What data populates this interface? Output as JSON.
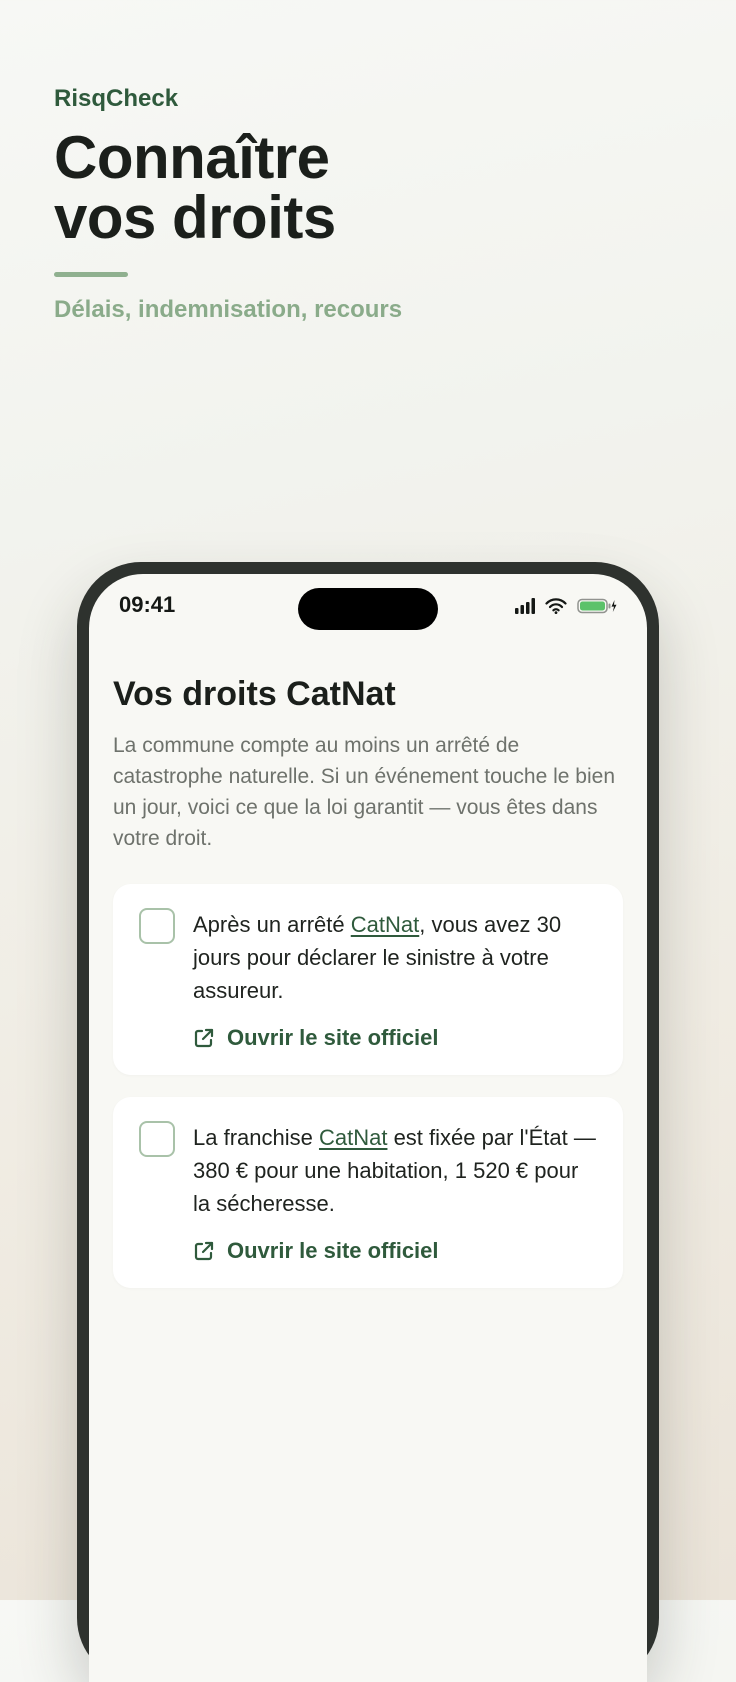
{
  "promo": {
    "brand": "RisqCheck",
    "headline_line1": "Connaître",
    "headline_line2": "vos droits",
    "subhead": "Délais, indemnisation, recours"
  },
  "status_bar": {
    "time": "09:41",
    "icons": [
      "signal-icon",
      "wifi-icon",
      "battery-charging-icon"
    ]
  },
  "screen": {
    "title": "Vos droits CatNat",
    "intro": "La commune compte au moins un arrêté de catastrophe naturelle. Si un événement touche le bien un jour, voici ce que la loi garantit — vous êtes dans votre droit.",
    "cards": [
      {
        "text_before": "Après un arrêté ",
        "term": "CatNat",
        "text_after": ", vous avez 30 jours pour déclarer le sinistre à votre assureur.",
        "link_label": "Ouvrir le site officiel",
        "link_icon": "external-link-icon",
        "checked": false
      },
      {
        "text_before": "La franchise ",
        "term": "CatNat",
        "text_after": " est fixée par l'État — 380 € pour une habitation, 1 520 € pour la sécheresse.",
        "link_label": "Ouvrir le site officiel",
        "link_icon": "external-link-icon",
        "checked": false
      }
    ]
  },
  "colors": {
    "accent_green": "#2f5a3c",
    "muted_green": "#8aab8a",
    "phone_frame": "#2e322e",
    "screen_background": "#f8f8f4",
    "battery_fill": "#5cc26a"
  }
}
